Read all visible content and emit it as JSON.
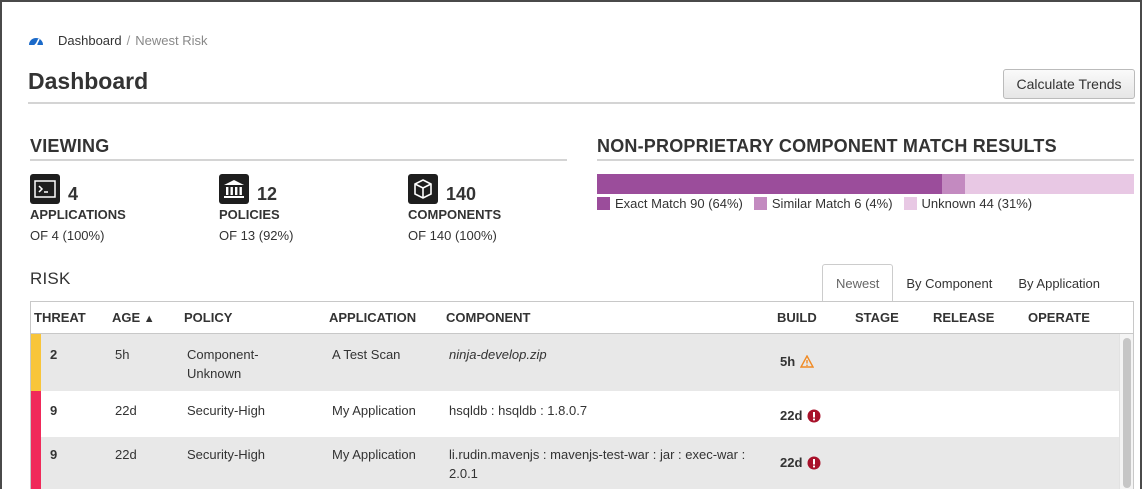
{
  "breadcrumb": {
    "home_icon": "dashboard-gauge-icon",
    "link": "Dashboard",
    "separator": "/",
    "current": "Newest Risk"
  },
  "page": {
    "title": "Dashboard",
    "calc_button": "Calculate Trends"
  },
  "viewing": {
    "heading": "VIEWING",
    "stats": [
      {
        "icon": "terminal-icon",
        "count": "4",
        "label": "APPLICATIONS",
        "of": "OF 4 (100%)"
      },
      {
        "icon": "bank-icon",
        "count": "12",
        "label": "POLICIES",
        "of": "OF 13 (92%)"
      },
      {
        "icon": "cube-icon",
        "count": "140",
        "label": "COMPONENTS",
        "of": "OF 140 (100%)"
      }
    ]
  },
  "match": {
    "heading": "NON-PROPRIETARY COMPONENT MATCH RESULTS",
    "segments": [
      {
        "label": "Exact Match 90 (64%)",
        "value": 90,
        "color": "#9b4d9b"
      },
      {
        "label": "Similar Match 6 (4%)",
        "value": 6,
        "color": "#c38ac0"
      },
      {
        "label": "Unknown 44 (31%)",
        "value": 44,
        "color": "#e8c8e4"
      }
    ]
  },
  "risk": {
    "heading": "RISK",
    "tabs": [
      "Newest",
      "By Component",
      "By Application"
    ],
    "active_tab": "Newest",
    "columns": [
      "THREAT",
      "AGE",
      "POLICY",
      "APPLICATION",
      "COMPONENT",
      "BUILD",
      "STAGE",
      "RELEASE",
      "OPERATE"
    ],
    "sort_indicator": "▲",
    "rows": [
      {
        "threat": "2",
        "threat_color": "#f8c53a",
        "age": "5h",
        "policy": "Component-Unknown",
        "application": "A Test Scan",
        "component": "ninja-develop.zip",
        "component_italic": true,
        "build": "5h",
        "build_icon": "warning-triangle-icon",
        "bg": "#e8e8e8"
      },
      {
        "threat": "9",
        "threat_color": "#f0295a",
        "age": "22d",
        "policy": "Security-High",
        "application": "My Application",
        "component": "hsqldb : hsqldb : 1.8.0.7",
        "component_italic": false,
        "build": "22d",
        "build_icon": "critical-alert-icon",
        "bg": "#ffffff"
      },
      {
        "threat": "9",
        "threat_color": "#f0295a",
        "age": "22d",
        "policy": "Security-High",
        "application": "My Application",
        "component": "li.rudin.mavenjs : mavenjs-test-war : jar : exec-war : 2.0.1",
        "component_italic": false,
        "build": "22d",
        "build_icon": "critical-alert-icon",
        "bg": "#e8e8e8"
      }
    ]
  },
  "colors": {
    "accent": "#1b6ac9",
    "warning": "#f08a24",
    "critical": "#a8112a"
  }
}
